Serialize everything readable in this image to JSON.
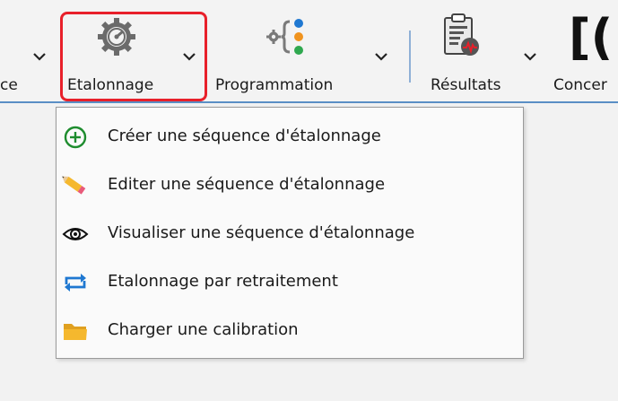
{
  "ribbon": {
    "items": [
      {
        "label": "ce"
      },
      {
        "label": "Etalonnage"
      },
      {
        "label": "Programmation"
      },
      {
        "label": "Résultats"
      },
      {
        "label": "Concer"
      }
    ],
    "cut_glyph": "[("
  },
  "menu": {
    "items": [
      {
        "label": "Créer une séquence d'étalonnage",
        "icon": "plus-circle-icon"
      },
      {
        "label": "Editer une séquence d'étalonnage",
        "icon": "pencil-icon"
      },
      {
        "label": "Visualiser une séquence d'étalonnage",
        "icon": "eye-icon"
      },
      {
        "label": "Etalonnage par retraitement",
        "icon": "refresh-arrows-icon"
      },
      {
        "label": "Charger une calibration",
        "icon": "folder-icon"
      }
    ]
  },
  "colors": {
    "highlight": "#e8202a",
    "accent_line": "#5a8fc5",
    "plus_green": "#1e8c2e",
    "arrows_blue": "#1f78d1",
    "folder_yellow": "#f5b82e"
  }
}
